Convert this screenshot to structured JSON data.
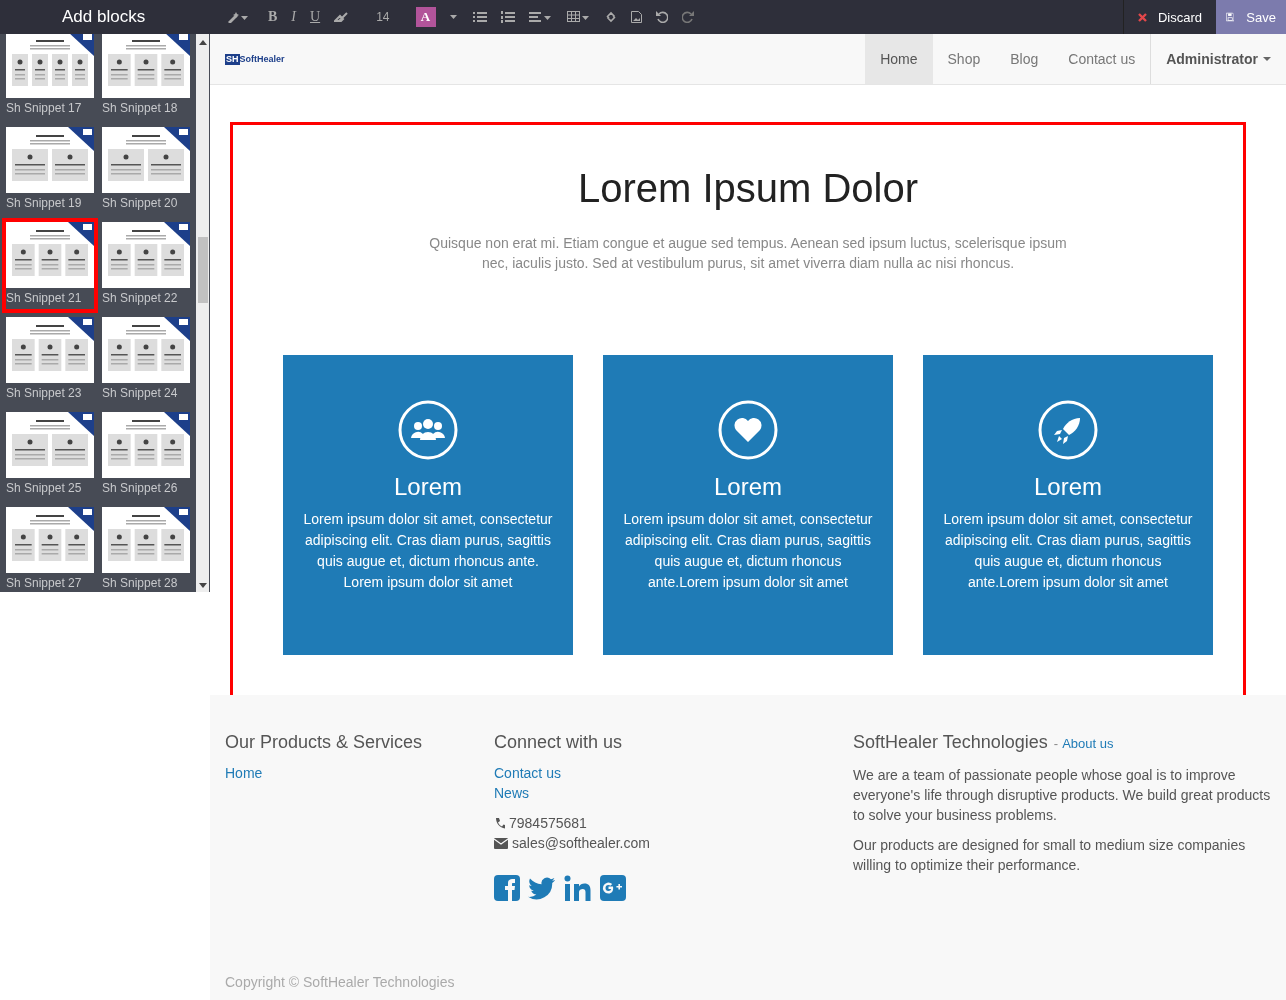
{
  "sidebar": {
    "title": "Add blocks",
    "snippets": [
      {
        "label": "Sh Snippet 17",
        "kind": "four",
        "selected": false
      },
      {
        "label": "Sh Snippet 18",
        "kind": "three",
        "selected": false
      },
      {
        "label": "Sh Snippet 19",
        "kind": "two",
        "selected": false
      },
      {
        "label": "Sh Snippet 20",
        "kind": "two",
        "selected": false
      },
      {
        "label": "Sh Snippet 21",
        "kind": "three",
        "selected": true
      },
      {
        "label": "Sh Snippet 22",
        "kind": "three",
        "selected": false
      },
      {
        "label": "Sh Snippet 23",
        "kind": "three",
        "selected": false
      },
      {
        "label": "Sh Snippet 24",
        "kind": "three",
        "selected": false
      },
      {
        "label": "Sh Snippet 25",
        "kind": "two",
        "selected": false
      },
      {
        "label": "Sh Snippet 26",
        "kind": "three",
        "selected": false
      },
      {
        "label": "Sh Snippet 27",
        "kind": "three",
        "selected": false
      },
      {
        "label": "Sh Snippet 28",
        "kind": "three",
        "selected": false
      }
    ]
  },
  "toolbar": {
    "bold": "B",
    "italic": "I",
    "underline": "U",
    "font_size": "14",
    "text_color_glyph": "A",
    "discard": "Discard",
    "save": "Save"
  },
  "navbar": {
    "logo_badge": "SH",
    "logo_text": "SoftHealer",
    "items": [
      {
        "label": "Home",
        "selected": true
      },
      {
        "label": "Shop",
        "selected": false
      },
      {
        "label": "Blog",
        "selected": false
      },
      {
        "label": "Contact us",
        "selected": false
      }
    ],
    "user": "Administrator"
  },
  "section": {
    "title": "Lorem Ipsum Dolor",
    "subtitle": "Quisque non erat mi. Etiam congue et augue sed tempus. Aenean sed ipsum luctus, scelerisque ipsum nec, iaculis justo. Sed at vestibulum purus, sit amet viverra diam nulla ac nisi rhoncus.",
    "cards": [
      {
        "title": "Lorem",
        "text": "Lorem ipsum dolor sit amet, consectetur adipiscing elit. Cras diam purus, sagittis quis augue et, dictum rhoncus ante. Lorem ipsum dolor sit amet"
      },
      {
        "title": "Lorem",
        "text": "Lorem ipsum dolor sit amet, consectetur adipiscing elit. Cras diam purus, sagittis quis augue et, dictum rhoncus ante.Lorem ipsum dolor sit amet"
      },
      {
        "title": "Lorem",
        "text": "Lorem ipsum dolor sit amet, consectetur adipiscing elit. Cras diam purus, sagittis quis augue et, dictum rhoncus ante.Lorem ipsum dolor sit amet"
      }
    ]
  },
  "footer": {
    "products": {
      "title": "Our Products & Services",
      "links": [
        "Home"
      ]
    },
    "connect": {
      "title": "Connect with us",
      "links": [
        "Contact us",
        "News"
      ],
      "phone": "7984575681",
      "email": "sales@softhealer.com"
    },
    "about": {
      "title": "SoftHealer Technologies",
      "separator": "-",
      "link": "About us",
      "paragraphs": [
        "We are a team of passionate people whose goal is to improve everyone's life through disruptive products. We build great products to solve your business problems.",
        "Our products are designed for small to medium size companies willing to optimize their performance."
      ]
    },
    "copyright": "Copyright © SoftHealer Technologies"
  }
}
